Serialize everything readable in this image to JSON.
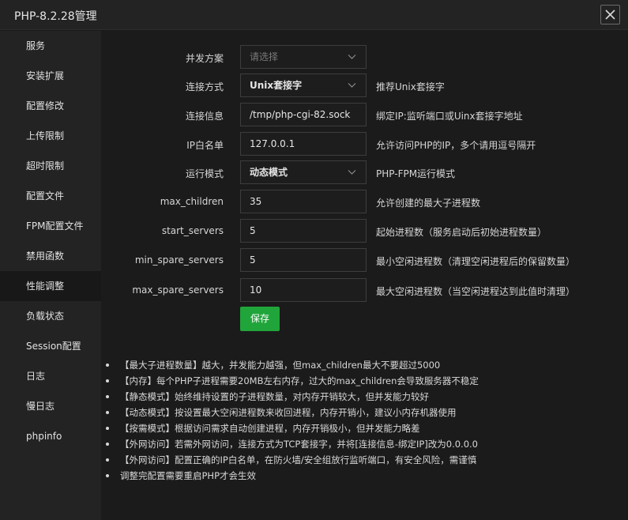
{
  "window": {
    "title": "PHP-8.2.28管理"
  },
  "sidebar": {
    "items": [
      {
        "label": "服务"
      },
      {
        "label": "安装扩展"
      },
      {
        "label": "配置修改"
      },
      {
        "label": "上传限制"
      },
      {
        "label": "超时限制"
      },
      {
        "label": "配置文件"
      },
      {
        "label": "FPM配置文件"
      },
      {
        "label": "禁用函数"
      },
      {
        "label": "性能调整",
        "active": true
      },
      {
        "label": "负载状态"
      },
      {
        "label": "Session配置"
      },
      {
        "label": "日志"
      },
      {
        "label": "慢日志"
      },
      {
        "label": "phpinfo"
      }
    ]
  },
  "form": {
    "concurrency_scheme": {
      "label": "并发方案",
      "placeholder": "请选择",
      "value": ""
    },
    "connection_method": {
      "label": "连接方式",
      "value": "Unix套接字",
      "hint": "推荐Unix套接字"
    },
    "connection_info": {
      "label": "连接信息",
      "value": "/tmp/php-cgi-82.sock",
      "hint": "绑定IP:监听端口或Uinx套接字地址"
    },
    "ip_whitelist": {
      "label": "IP白名单",
      "value": "127.0.0.1",
      "hint": "允许访问PHP的IP，多个请用逗号隔开"
    },
    "run_mode": {
      "label": "运行模式",
      "value": "动态模式",
      "hint": "PHP-FPM运行模式"
    },
    "max_children": {
      "label": "max_children",
      "value": "35",
      "hint": "允许创建的最大子进程数"
    },
    "start_servers": {
      "label": "start_servers",
      "value": "5",
      "hint": "起始进程数（服务启动后初始进程数量）"
    },
    "min_spare_servers": {
      "label": "min_spare_servers",
      "value": "5",
      "hint": "最小空闲进程数（清理空闲进程后的保留数量）"
    },
    "max_spare_servers": {
      "label": "max_spare_servers",
      "value": "10",
      "hint": "最大空闲进程数（当空闲进程达到此值时清理）"
    },
    "save_label": "保存"
  },
  "notes": [
    "【最大子进程数量】越大，并发能力越强，但max_children最大不要超过5000",
    "【内存】每个PHP子进程需要20MB左右内存，过大的max_children会导致服务器不稳定",
    "【静态模式】始终维持设置的子进程数量，对内存开销较大，但并发能力较好",
    "【动态模式】按设置最大空闲进程数来收回进程，内存开销小，建议小内存机器使用",
    "【按需模式】根据访问需求自动创建进程，内存开销极小，但并发能力略差",
    "【外网访问】若需外网访问，连接方式为TCP套接字，并将[连接信息-绑定IP]改为0.0.0.0",
    "【外网访问】配置正确的IP白名单，在防火墙/安全组放行监听端口，有安全风险，需谨慎",
    "调整完配置需要重启PHP才会生效"
  ],
  "colors": {
    "accent_green": "#20a53a",
    "background": "#1b1b1b",
    "sidebar": "#232323"
  },
  "icons": {
    "close": "close-icon",
    "dropdown": "chevron-down-icon"
  }
}
